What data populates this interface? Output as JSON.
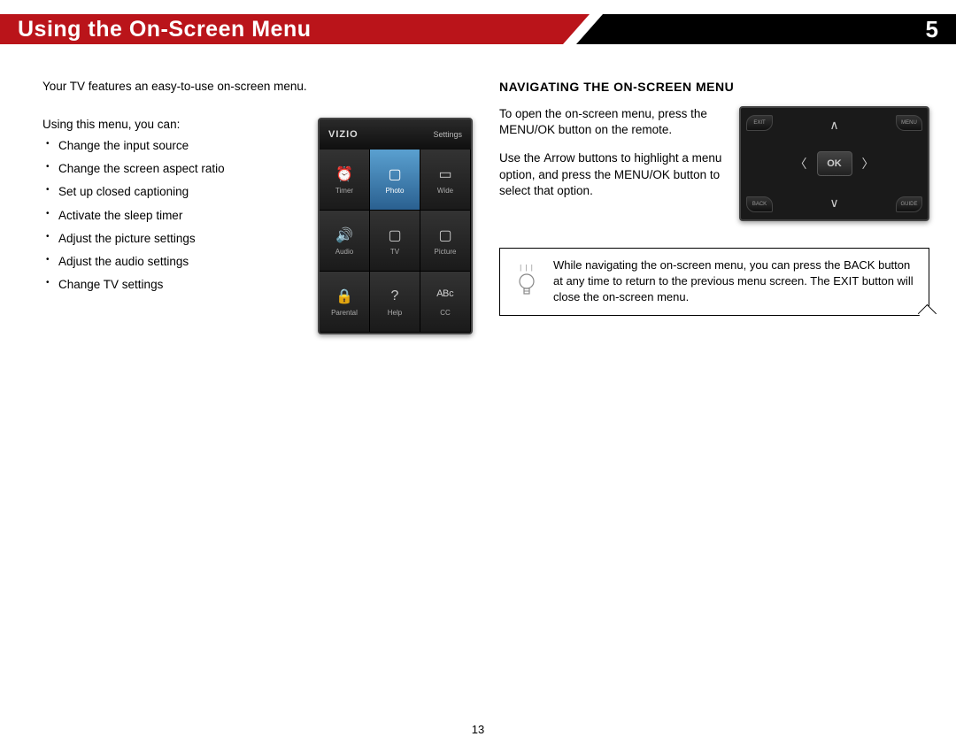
{
  "header": {
    "title": "Using the On-Screen Menu",
    "chapter": "5"
  },
  "left": {
    "intro": "Your TV features an easy-to-use on-screen menu.",
    "using": "Using this menu, you can:",
    "bullets": [
      "Change the input source",
      "Change the screen aspect ratio",
      "Set up closed captioning",
      "Activate the sleep timer",
      "Adjust the picture settings",
      "Adjust the audio settings",
      "Change TV settings"
    ]
  },
  "tvmenu": {
    "brand": "VIZIO",
    "corner": "Settings",
    "cells": [
      {
        "label": "Timer",
        "icon": "⏰"
      },
      {
        "label": "Photo",
        "icon": "▢",
        "selected": true
      },
      {
        "label": "Wide",
        "icon": "▭"
      },
      {
        "label": "Audio",
        "icon": "🔊"
      },
      {
        "label": "TV",
        "icon": "▢"
      },
      {
        "label": "Picture",
        "icon": "▢"
      },
      {
        "label": "Parental",
        "icon": "🔒"
      },
      {
        "label": "Help",
        "icon": "?"
      },
      {
        "label": "CC",
        "icon": "ᴬᴮᶜ"
      }
    ]
  },
  "right": {
    "heading": "NAVIGATING THE ON-SCREEN MENU",
    "p1_a": "To open the on-screen menu, press the ",
    "p1_bold": "MENU/OK",
    "p1_b": " button on the remote.",
    "p2_a": "Use the ",
    "p2_bold1": "Arrow",
    "p2_b": " buttons to highlight a menu option, and press the ",
    "p2_bold2": "MENU/OK",
    "p2_c": " button to select that option."
  },
  "remote": {
    "ok": "OK",
    "exit": "EXIT",
    "menu": "MENU",
    "back": "BACK",
    "guide": "GUIDE"
  },
  "tip": {
    "t1": "While navigating the on-screen menu, you can press the ",
    "b1": "BACK",
    "t2": " button at any time to return to the previous menu screen. The ",
    "b2": "EXIT",
    "t3": " button will close the on-screen menu."
  },
  "page": "13"
}
